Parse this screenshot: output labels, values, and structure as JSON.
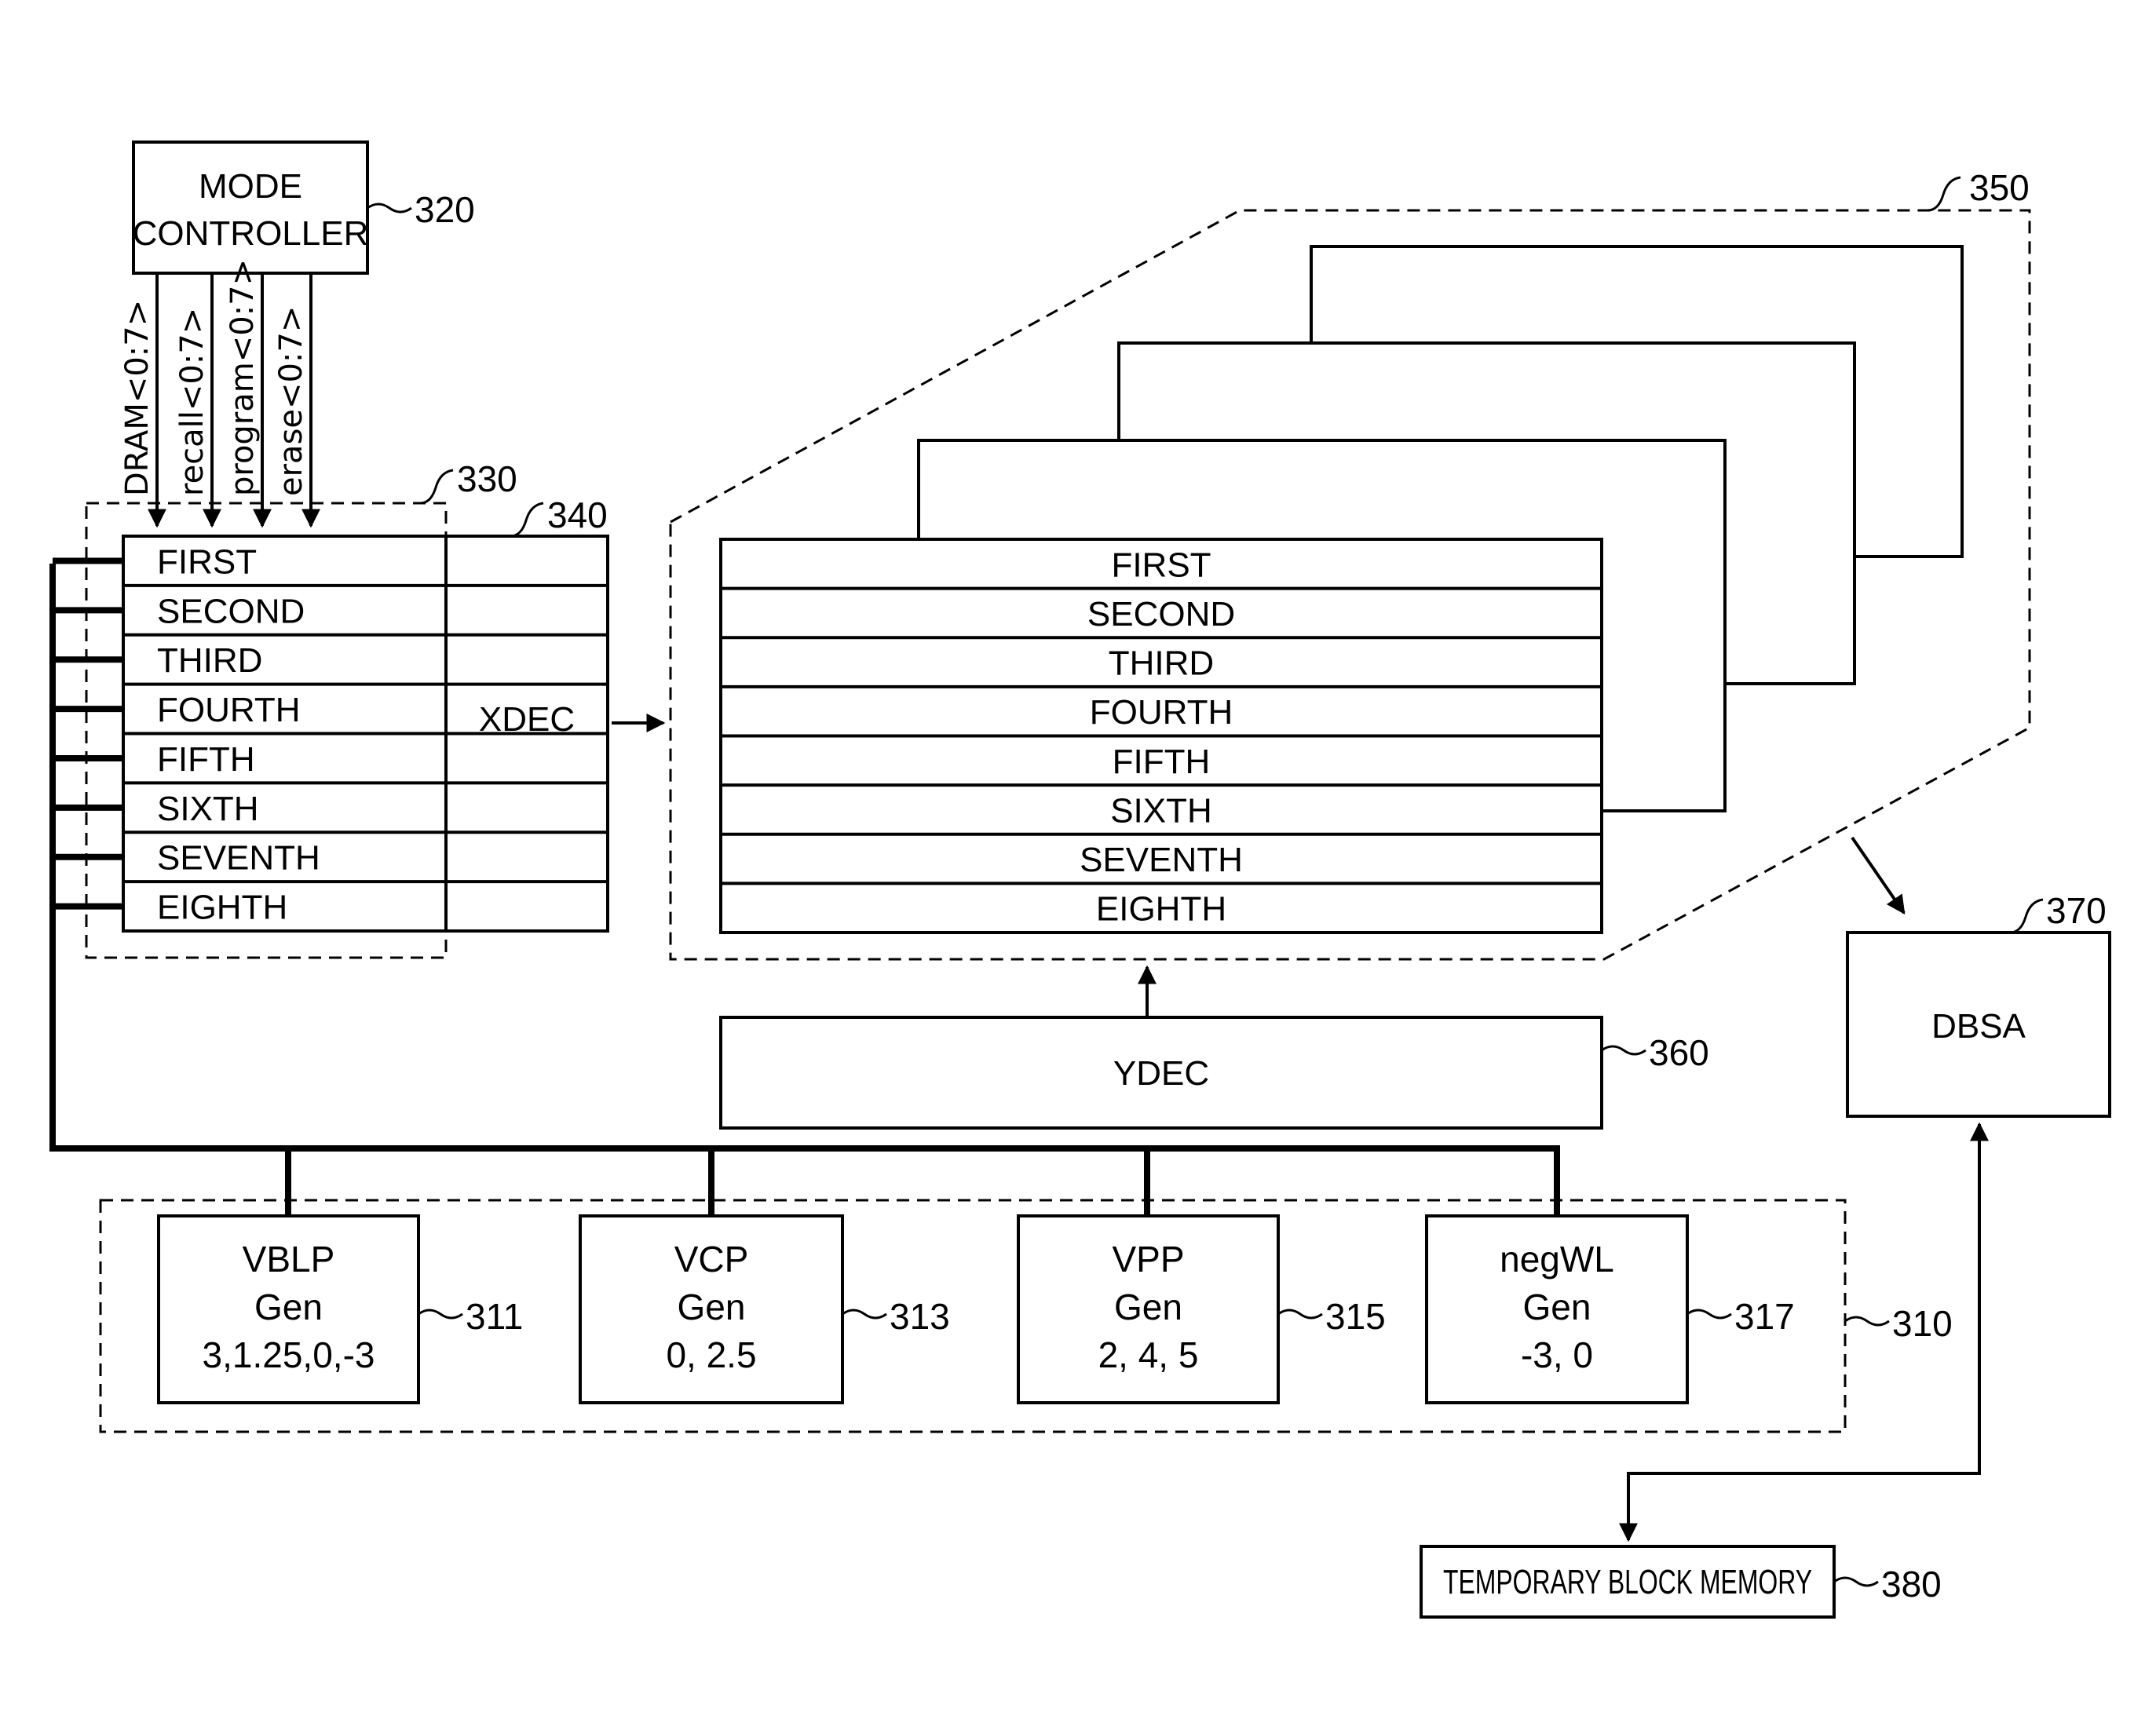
{
  "figure": {
    "mode_controller": {
      "lines": [
        "MODE",
        "CONTROLLER"
      ],
      "ref": "320"
    },
    "mode_signals": [
      "DRAM<0:7>",
      "recall<0:7>",
      "program<0:7>",
      "erase<0:7>"
    ],
    "register_block": {
      "ref": "330"
    },
    "xdec_block": {
      "ref": "340",
      "label": "XDEC"
    },
    "rows": [
      "FIRST",
      "SECOND",
      "THIRD",
      "FOURTH",
      "FIFTH",
      "SIXTH",
      "SEVENTH",
      "EIGHTH"
    ],
    "memory_array": {
      "ref": "350",
      "rows": [
        "FIRST",
        "SECOND",
        "THIRD",
        "FOURTH",
        "FIFTH",
        "SIXTH",
        "SEVENTH",
        "EIGHTH"
      ]
    },
    "ydec": {
      "label": "YDEC",
      "ref": "360"
    },
    "dbsa": {
      "label": "DBSA",
      "ref": "370"
    },
    "temp_memory": {
      "label": "TEMPORARY BLOCK MEMORY",
      "ref": "380"
    },
    "voltage_block": {
      "ref": "310"
    },
    "generators": [
      {
        "name": "VBLP",
        "sub": "Gen",
        "values": "3,1.25,0,-3",
        "ref": "311"
      },
      {
        "name": "VCP",
        "sub": "Gen",
        "values": "0, 2.5",
        "ref": "313"
      },
      {
        "name": "VPP",
        "sub": "Gen",
        "values": "2, 4, 5",
        "ref": "315"
      },
      {
        "name": "negWL",
        "sub": "Gen",
        "values": "-3, 0",
        "ref": "317"
      }
    ]
  }
}
